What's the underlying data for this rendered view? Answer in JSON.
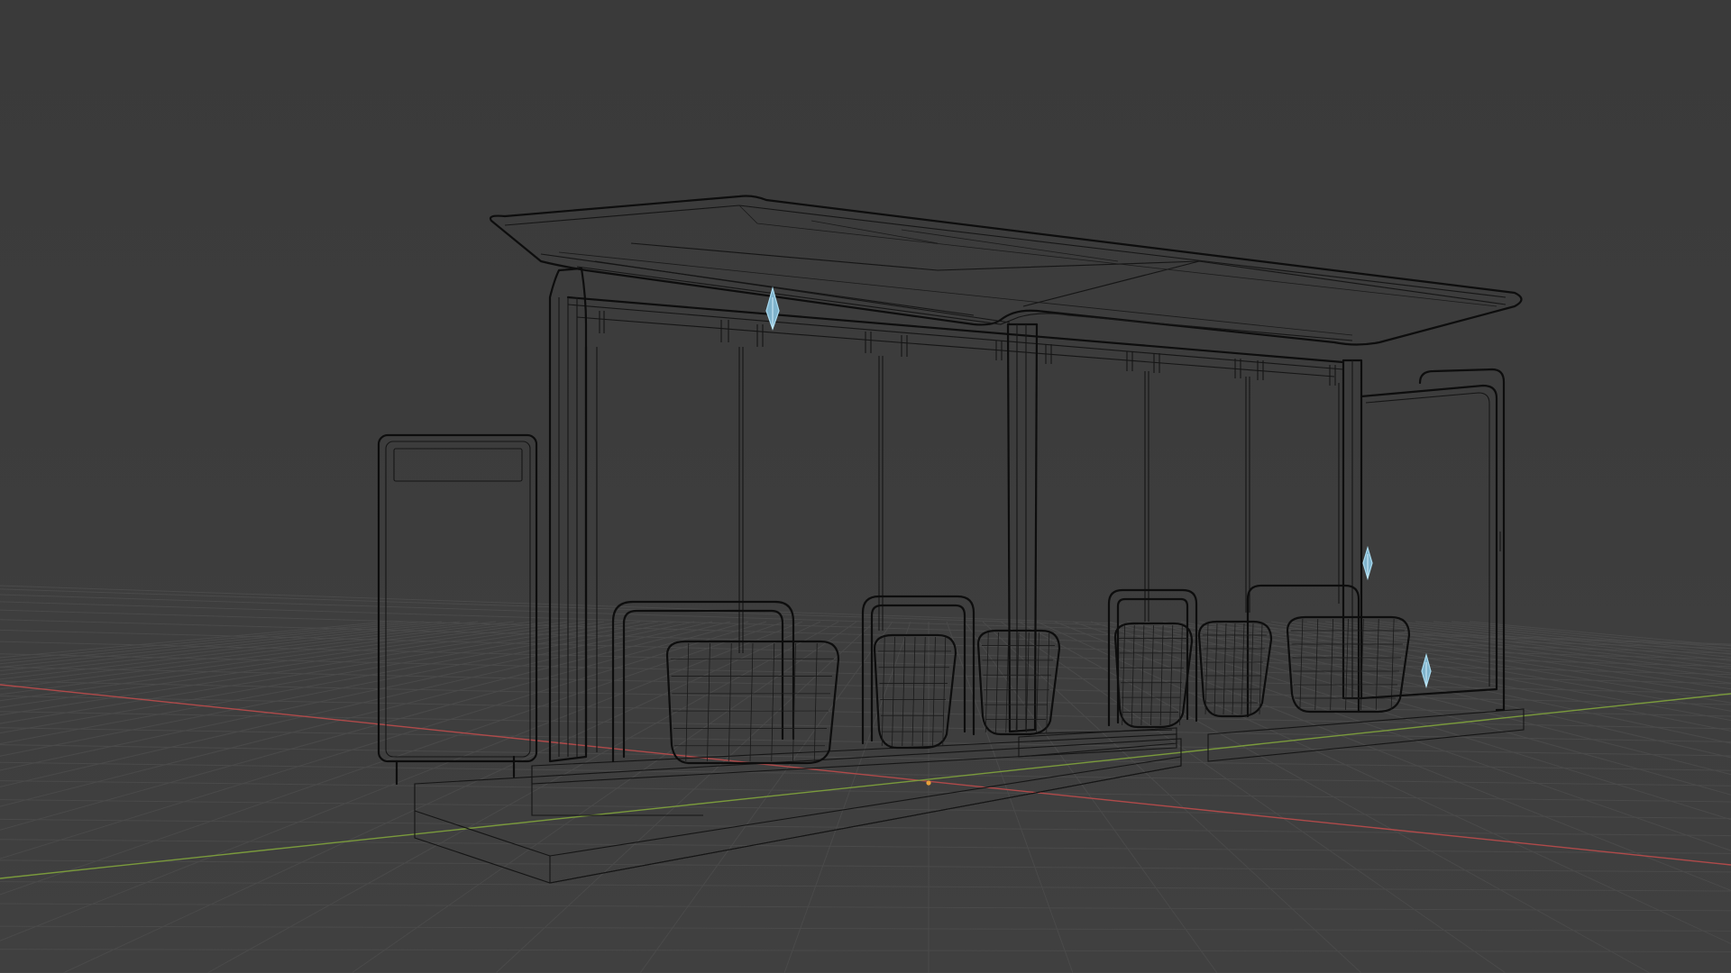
{
  "viewport": {
    "mode": "wireframe",
    "scene_object": "bus-shelter",
    "colors": {
      "background": "#3d3d3d",
      "grid": "#4a4a4a",
      "wire": "#0d0d0d",
      "x_axis": "#b04a4a",
      "y_axis": "#7a9a3c",
      "light": "#7fb3cc",
      "origin": "#e8a13a"
    },
    "icons": [
      "light-icon",
      "origin-point-icon"
    ]
  }
}
